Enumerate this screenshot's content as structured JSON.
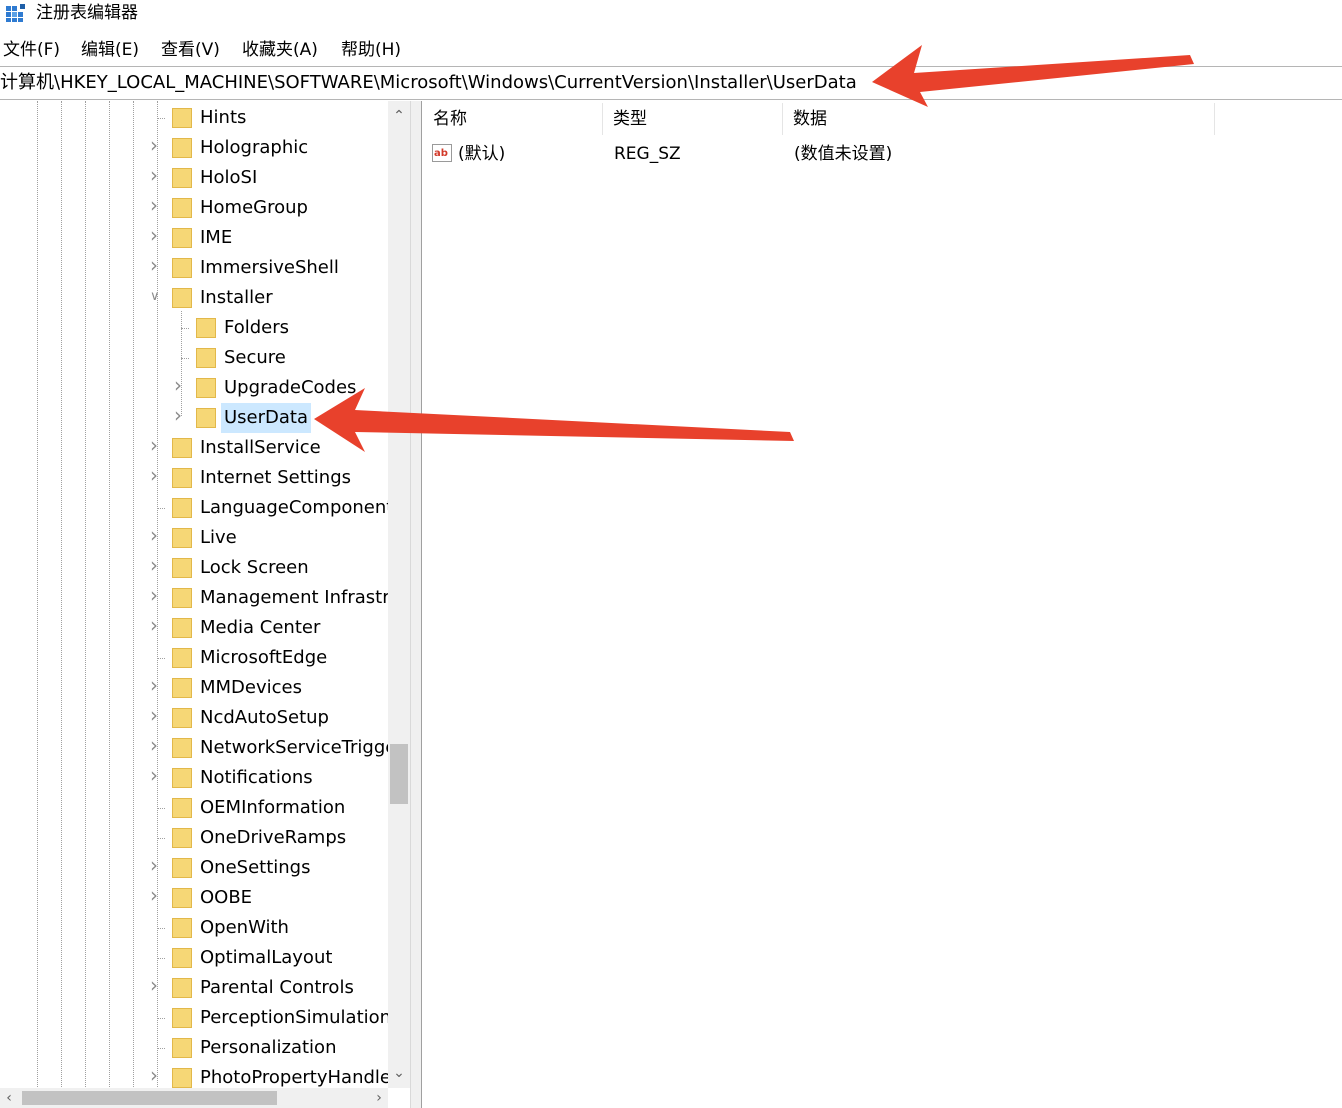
{
  "window": {
    "title": "注册表编辑器"
  },
  "menu": {
    "file": "文件(F)",
    "edit": "编辑(E)",
    "view": "查看(V)",
    "favorites": "收藏夹(A)",
    "help": "帮助(H)"
  },
  "address": {
    "path": "计算机\\HKEY_LOCAL_MACHINE\\SOFTWARE\\Microsoft\\Windows\\CurrentVersion\\Installer\\UserData"
  },
  "tree": {
    "nodes": [
      {
        "label": "Hints",
        "expander": "none"
      },
      {
        "label": "Holographic",
        "expander": "collapsed"
      },
      {
        "label": "HoloSI",
        "expander": "collapsed"
      },
      {
        "label": "HomeGroup",
        "expander": "collapsed"
      },
      {
        "label": "IME",
        "expander": "collapsed"
      },
      {
        "label": "ImmersiveShell",
        "expander": "collapsed"
      },
      {
        "label": "Installer",
        "expander": "expanded"
      },
      {
        "label": "Folders",
        "expander": "none",
        "child": true
      },
      {
        "label": "Secure",
        "expander": "none",
        "child": true
      },
      {
        "label": "UpgradeCodes",
        "expander": "collapsed",
        "child": true
      },
      {
        "label": "UserData",
        "expander": "collapsed",
        "child": true,
        "selected": true
      },
      {
        "label": "InstallService",
        "expander": "collapsed"
      },
      {
        "label": "Internet Settings",
        "expander": "collapsed"
      },
      {
        "label": "LanguageComponent",
        "expander": "none"
      },
      {
        "label": "Live",
        "expander": "collapsed"
      },
      {
        "label": "Lock Screen",
        "expander": "collapsed"
      },
      {
        "label": "Management Infrastru",
        "expander": "collapsed"
      },
      {
        "label": "Media Center",
        "expander": "collapsed"
      },
      {
        "label": "MicrosoftEdge",
        "expander": "none"
      },
      {
        "label": "MMDevices",
        "expander": "collapsed"
      },
      {
        "label": "NcdAutoSetup",
        "expander": "collapsed"
      },
      {
        "label": "NetworkServiceTrigge",
        "expander": "collapsed"
      },
      {
        "label": "Notifications",
        "expander": "collapsed"
      },
      {
        "label": "OEMInformation",
        "expander": "none"
      },
      {
        "label": "OneDriveRamps",
        "expander": "none"
      },
      {
        "label": "OneSettings",
        "expander": "collapsed"
      },
      {
        "label": "OOBE",
        "expander": "collapsed"
      },
      {
        "label": "OpenWith",
        "expander": "none"
      },
      {
        "label": "OptimalLayout",
        "expander": "none"
      },
      {
        "label": "Parental Controls",
        "expander": "collapsed"
      },
      {
        "label": "PerceptionSimulationE",
        "expander": "none"
      },
      {
        "label": "Personalization",
        "expander": "none"
      },
      {
        "label": "PhotoPropertyHandle",
        "expander": "collapsed"
      }
    ]
  },
  "list": {
    "columns": {
      "name": "名称",
      "type": "类型",
      "data": "数据"
    },
    "rows": [
      {
        "name": "(默认)",
        "type": "REG_SZ",
        "data": "(数值未设置)",
        "icon": "ab-string-icon"
      }
    ]
  },
  "colors": {
    "folder": "#f6d776",
    "folder_edge": "#e2b84a",
    "selection": "#cce8ff",
    "arrow": "#e8412c"
  }
}
